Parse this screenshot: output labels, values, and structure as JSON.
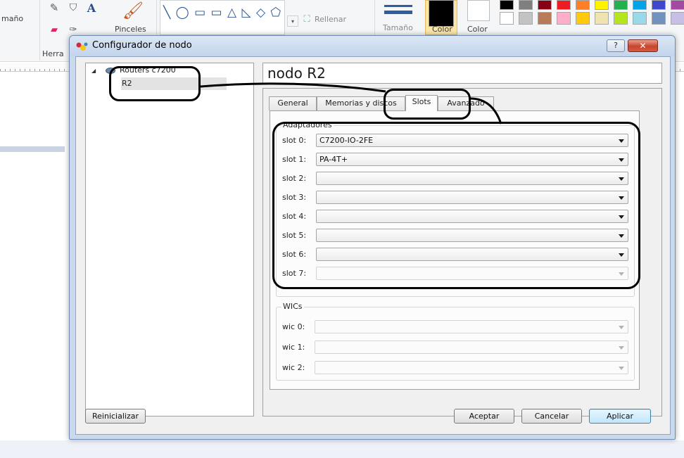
{
  "paint": {
    "size_label": "maño",
    "brushes_label": "Pinceles",
    "tools_label": "Herra",
    "fill_label": "Rellenar",
    "outline_size_label": "Tamaño",
    "color1_label": "Color",
    "color2_label": "Color",
    "shapes_glyphs": "╲ ◯ ▭ ▭ △ ◺ ◇ ⬠ ⬡ ⇨ ⇦ ⇧",
    "palette": [
      "#ffffff",
      "#c3c3c3",
      "#b97a57",
      "#ffaec9",
      "#ffc90e",
      "#efe4b0",
      "#b5e61d",
      "#99d9ea",
      "#7092be",
      "#c8bfe7"
    ]
  },
  "dialog": {
    "title": "Configurador de nodo",
    "help_label": "?",
    "close_label": "✕",
    "tree": {
      "root_label": "Routers c7200",
      "items": [
        "R2"
      ]
    },
    "node_title": "nodo R2",
    "tabs": [
      "General",
      "Memorias y discos",
      "Slots",
      "Avanzado"
    ],
    "active_tab": "Slots",
    "adapters": {
      "title": "Adaptadores",
      "slots": [
        {
          "label": "slot 0:",
          "value": "C7200-IO-2FE"
        },
        {
          "label": "slot 1:",
          "value": "PA-4T+"
        },
        {
          "label": "slot 2:",
          "value": ""
        },
        {
          "label": "slot 3:",
          "value": ""
        },
        {
          "label": "slot 4:",
          "value": ""
        },
        {
          "label": "slot 5:",
          "value": ""
        },
        {
          "label": "slot 6:",
          "value": ""
        },
        {
          "label": "slot 7:",
          "value": ""
        }
      ]
    },
    "wics": {
      "title": "WICs",
      "items": [
        {
          "label": "wic 0:",
          "value": ""
        },
        {
          "label": "wic 1:",
          "value": ""
        },
        {
          "label": "wic 2:",
          "value": ""
        }
      ]
    },
    "buttons": {
      "reset": "Reinicializar",
      "accept": "Aceptar",
      "cancel": "Cancelar",
      "apply": "Aplicar"
    }
  }
}
